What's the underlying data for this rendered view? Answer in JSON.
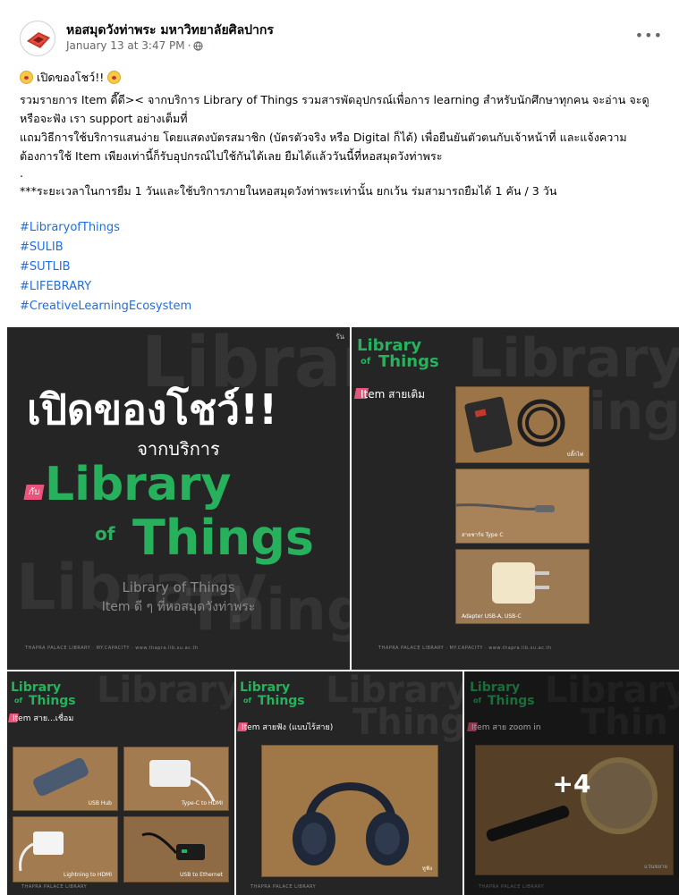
{
  "post": {
    "page_name": "หอสมุดวังท่าพระ มหาวิทยาลัยศิลปากร",
    "timestamp": "January 13 at 3:47 PM",
    "separator": "·",
    "more_label": "•••",
    "headline": "เปิดของโชว์!!",
    "paragraph1": "รวมรายการ Item ดี๊ดี>< จากบริการ Library of Things รวมสารพัดอุปกรณ์เพื่อการ learning สำหรับนักศึกษาทุกคน จะอ่าน จะดู หรือจะฟัง เรา support อย่างเต็มที่",
    "paragraph2": "แถมวิธีการใช้บริการแสนง่าย โดยแสดงบัตรสมาชิก (บัตรตัวจริง หรือ Digital ก็ได้) เพื่อยืนยันตัวตนกับเจ้าหน้าที่ และแจ้งความต้องการใช้ Item เพียงเท่านี้ก็รับอุปกรณ์ไปใช้กันได้เลย ยืมได้แล้ววันนี้ที่หอสมุดวังท่าพระ",
    "dot": ".",
    "paragraph3": "***ระยะเวลาในการยืม 1 วันและใช้บริการภายในหอสมุดวังท่าพระเท่านั้น ยกเว้น ร่มสามารถยืมได้ 1 คัน / 3 วัน",
    "hashtags": [
      "#LibraryofThings",
      "#SULIB",
      "#SUTLIB",
      "#LIFEBRARY",
      "#CreativeLearningEcosystem"
    ]
  },
  "images": {
    "tile1": {
      "ghost_text": "Library",
      "ghost_text2": "Things",
      "corner": "รัน",
      "headline": "เปิดของโชว์!!",
      "sub": "จากบริการ",
      "tag": "กับ",
      "logo_word1": "Library",
      "logo_of": "of",
      "logo_word2": "Things",
      "caption1": "Library of Things",
      "caption2": "Item ดี ๆ ที่หอสมุดวังท่าพระ",
      "footer": "THAPRA PALACE LIBRARY   ·   MY.CAPACITY   ·   www.thapra.lib.su.ac.th"
    },
    "tile2": {
      "logo_word1": "Library",
      "logo_of": "of",
      "logo_word2": "Things",
      "ghost_text": "Library",
      "ghost_text2": "ing",
      "label": "Item สายเติม",
      "cap1": "ปลั๊กไฟ",
      "cap2": "สายชาร์จ Type C",
      "cap3": "Adapter USB-A, USB-C",
      "footer": "THAPRA PALACE LIBRARY   ·   MY.CAPACITY   ·   www.thapra.lib.su.ac.th"
    },
    "tile3": {
      "logo_word1": "Library",
      "logo_of": "of",
      "logo_word2": "Things",
      "ghost_text": "Library",
      "label": "Item สาย...เชื่อม",
      "cap1": "USB Hub",
      "cap2": "Type-C to HDMI",
      "cap3": "Lightning to HDMI",
      "cap4": "USB to Ethernet",
      "footer": "THAPRA PALACE LIBRARY"
    },
    "tile4": {
      "logo_word1": "Library",
      "logo_of": "of",
      "logo_word2": "Things",
      "ghost_text": "Library",
      "ghost_text2": "Thing",
      "label": "Item สายฟัง (แบบไร้สาย)",
      "cap1": "หูฟัง",
      "footer": "THAPRA PALACE LIBRARY"
    },
    "tile5": {
      "logo_word1": "Library",
      "logo_of": "of",
      "logo_word2": "Things",
      "ghost_text": "Library",
      "ghost_text2": "Thin",
      "label": "Item สาย zoom in",
      "cap1": "แว่นขยาย",
      "more_count": "+4",
      "footer": "THAPRA PALACE LIBRARY"
    }
  },
  "colors": {
    "brand_green": "#27b15c",
    "hashtag_blue": "#216fdb",
    "tile_bg": "#252526",
    "tag_pink": "#e8547a"
  },
  "icons": {
    "audience": "globe-icon",
    "more": "more-options-icon",
    "avatar": "library-logo-icon"
  }
}
